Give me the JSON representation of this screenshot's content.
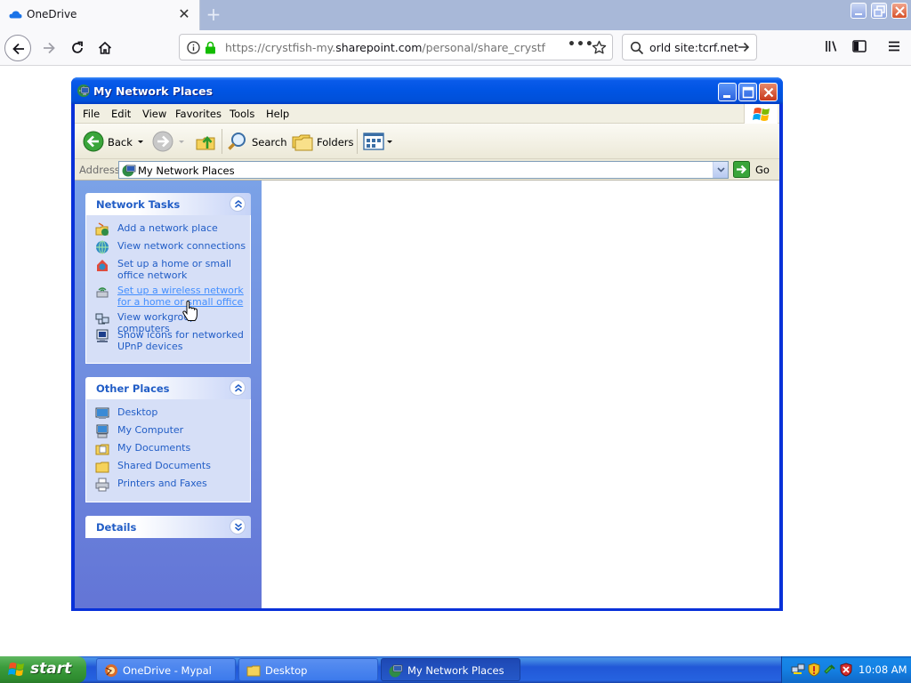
{
  "browser": {
    "tab_title": "OneDrive",
    "url_base": "https://crystfish-my.",
    "url_domain": "sharepoint.com",
    "url_path": "/personal/share_crystfish",
    "search_value": "orld site:tcrf.net",
    "icons": [
      "onedrive-icon",
      "back-icon",
      "forward-icon",
      "reload-icon",
      "home-icon",
      "info-icon",
      "lock-icon",
      "page-actions-icon",
      "bookmark-star-icon",
      "search-icon",
      "library-icon",
      "sidebar-icon",
      "menu-icon"
    ]
  },
  "window": {
    "title": "My Network Places",
    "menu": [
      "File",
      "Edit",
      "View",
      "Favorites",
      "Tools",
      "Help"
    ],
    "toolbar": {
      "back": "Back",
      "search": "Search",
      "folders": "Folders"
    },
    "address": {
      "label": "Address",
      "value": "My Network Places",
      "go": "Go"
    }
  },
  "taskpane": {
    "network_tasks": {
      "title": "Network Tasks",
      "items": [
        {
          "label": "Add a network place",
          "icon": "add-network-place-icon"
        },
        {
          "label": "View network connections",
          "icon": "network-connections-icon"
        },
        {
          "label": "Set up a home or small office network",
          "icon": "home-network-icon"
        },
        {
          "label": "Set up a wireless network for a home or small office",
          "icon": "wireless-network-icon"
        },
        {
          "label": "View workgroup computers",
          "icon": "workgroup-computers-icon"
        },
        {
          "label": "Show icons for networked UPnP devices",
          "icon": "upnp-devices-icon"
        }
      ]
    },
    "other_places": {
      "title": "Other Places",
      "items": [
        {
          "label": "Desktop",
          "icon": "desktop-icon"
        },
        {
          "label": "My Computer",
          "icon": "my-computer-icon"
        },
        {
          "label": "My Documents",
          "icon": "my-documents-icon"
        },
        {
          "label": "Shared Documents",
          "icon": "shared-documents-icon"
        },
        {
          "label": "Printers and Faxes",
          "icon": "printers-faxes-icon"
        }
      ]
    },
    "details": {
      "title": "Details"
    }
  },
  "taskbar": {
    "start": "start",
    "tasks": [
      {
        "label": "OneDrive - Mypal",
        "active": false
      },
      {
        "label": "Desktop",
        "active": false
      },
      {
        "label": "My Network Places",
        "active": true
      }
    ],
    "clock": "10:08 AM"
  },
  "colors": {
    "xp_title_blue": "#0054e3",
    "taskpane_link": "#215dc6",
    "taskpane_bg": "#6375d6",
    "start_green": "#3c9c3d"
  }
}
